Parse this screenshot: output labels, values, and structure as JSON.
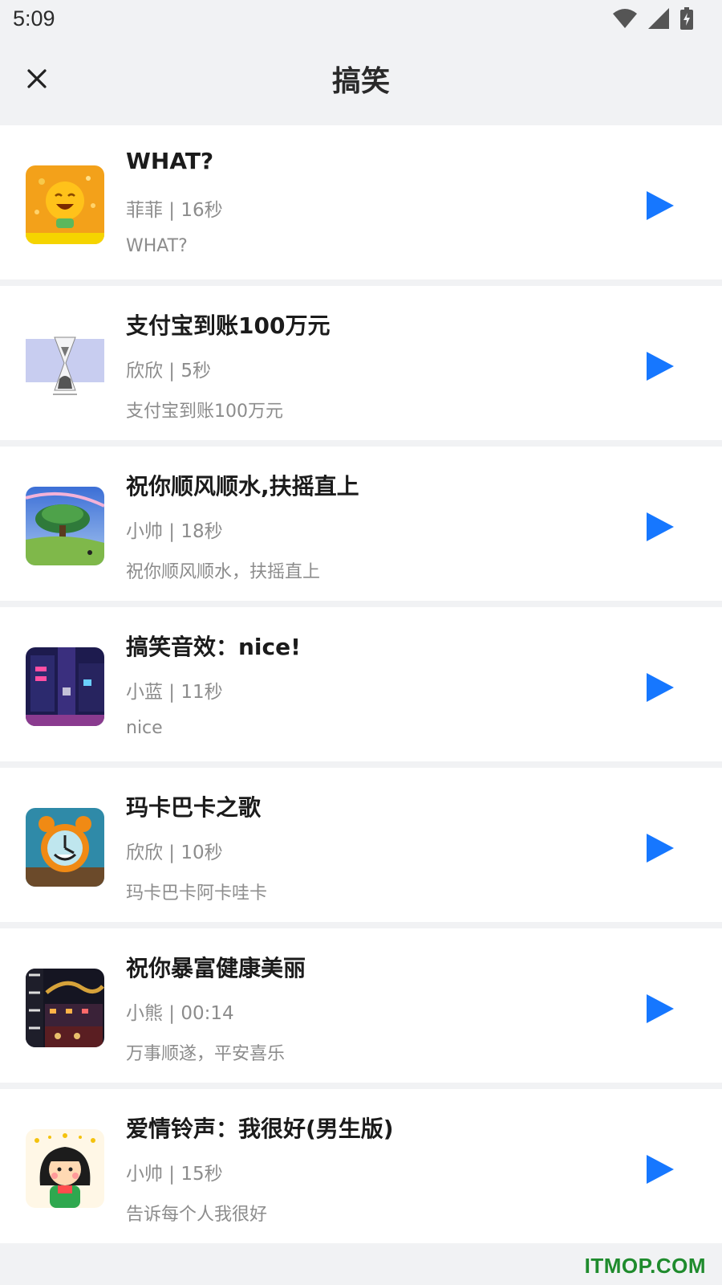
{
  "status_bar": {
    "time": "5:09",
    "icons": [
      "wifi-icon",
      "cellular-signal-icon",
      "battery-charging-icon"
    ]
  },
  "header": {
    "close_icon": "close-icon",
    "title": "搞笑"
  },
  "accent_color": "#1677ff",
  "items": [
    {
      "title": "WHAT?",
      "meta": "菲菲 | 16秒",
      "desc": "WHAT?",
      "thumb": "laughing-emoji-cover"
    },
    {
      "title": "支付宝到账100万元",
      "meta": "欣欣 | 5秒",
      "desc": "支付宝到账100万元",
      "thumb": "hourglass-cover"
    },
    {
      "title": "祝你顺风顺水,扶摇直上",
      "meta": "小帅 | 18秒",
      "desc": "祝你顺风顺水，扶摇直上",
      "thumb": "tree-landscape-cover"
    },
    {
      "title": "搞笑音效：nice!",
      "meta": "小蓝 | 11秒",
      "desc": "nice",
      "thumb": "night-street-cover"
    },
    {
      "title": "玛卡巴卡之歌",
      "meta": "欣欣 | 10秒",
      "desc": "玛卡巴卡阿卡哇卡",
      "thumb": "alarm-clock-cover"
    },
    {
      "title": "祝你暴富健康美丽",
      "meta": "小熊 | 00:14",
      "desc": "万事顺遂，平安喜乐",
      "thumb": "dragon-night-cover"
    },
    {
      "title": "爱情铃声：我很好(男生版)",
      "meta": "小帅 | 15秒",
      "desc": "告诉每个人我很好",
      "thumb": "cartoon-girl-cover"
    }
  ],
  "watermark": "ITMOP.COM"
}
